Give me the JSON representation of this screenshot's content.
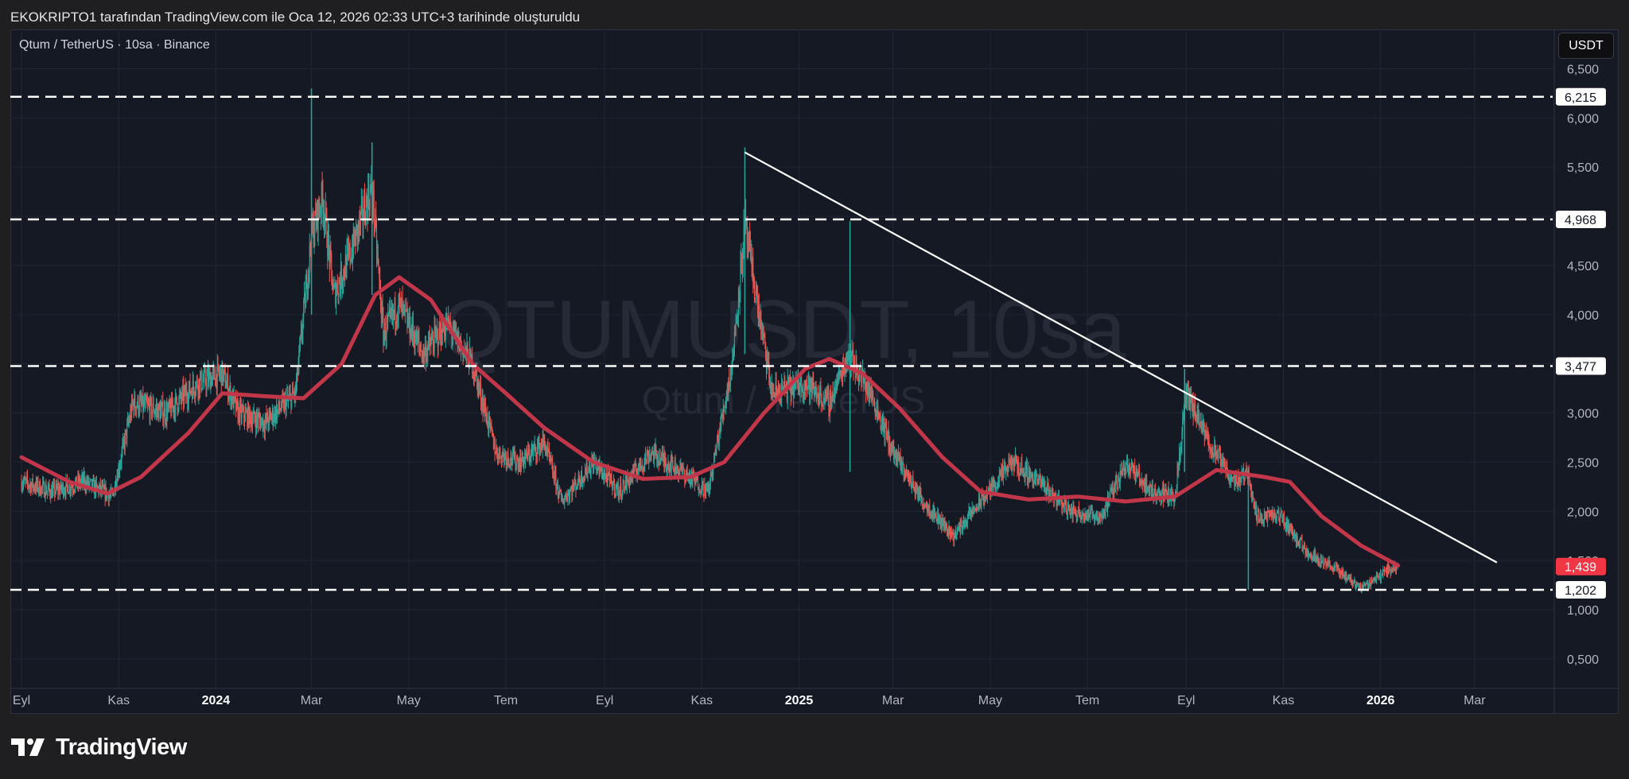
{
  "caption": "EKOKRIPTO1 tarafından TradingView.com ile Oca 12, 2026 02:33 UTC+3 tarihinde oluşturuldu",
  "symbol_title": "Qtum / TetherUS · 10sa · Binance",
  "currency_button": "USDT",
  "brand": "TradingView",
  "colors": {
    "background": "#151924",
    "up": "#26a69a",
    "down": "#ef5350",
    "ma": "#c2364a",
    "trendline": "#ffffff",
    "level": "#ffffff",
    "price_tag": "#f23645"
  },
  "chart_data": {
    "type": "candlestick",
    "watermark": {
      "symbol": "QTUMUSDT, 10sa",
      "name": "Qtum / TetherUS"
    },
    "y_axis": {
      "ticks": [
        "6,500",
        "6,000",
        "5,500",
        "5,000",
        "4,500",
        "4,000",
        "3,500",
        "3,000",
        "2,500",
        "2,000",
        "1,500",
        "1,000",
        "0,500"
      ],
      "tick_values": [
        6.5,
        6.0,
        5.5,
        5.0,
        4.5,
        4.0,
        3.5,
        3.0,
        2.5,
        2.0,
        1.5,
        1.0,
        0.5
      ],
      "range": [
        0.2,
        6.9
      ]
    },
    "x_axis": {
      "labels": [
        {
          "text": "Eyl",
          "date": "2023-09-01",
          "bold": false
        },
        {
          "text": "Kas",
          "date": "2023-11-01",
          "bold": false
        },
        {
          "text": "2024",
          "date": "2024-01-01",
          "bold": true
        },
        {
          "text": "Mar",
          "date": "2024-03-01",
          "bold": false
        },
        {
          "text": "May",
          "date": "2024-05-01",
          "bold": false
        },
        {
          "text": "Tem",
          "date": "2024-07-01",
          "bold": false
        },
        {
          "text": "Eyl",
          "date": "2024-09-01",
          "bold": false
        },
        {
          "text": "Kas",
          "date": "2024-11-01",
          "bold": false
        },
        {
          "text": "2025",
          "date": "2025-01-01",
          "bold": true
        },
        {
          "text": "Mar",
          "date": "2025-03-01",
          "bold": false
        },
        {
          "text": "May",
          "date": "2025-05-01",
          "bold": false
        },
        {
          "text": "Tem",
          "date": "2025-07-01",
          "bold": false
        },
        {
          "text": "Eyl",
          "date": "2025-09-01",
          "bold": false
        },
        {
          "text": "Kas",
          "date": "2025-11-01",
          "bold": false
        },
        {
          "text": "2026",
          "date": "2026-01-01",
          "bold": true
        },
        {
          "text": "Mar",
          "date": "2026-03-01",
          "bold": false
        }
      ]
    },
    "price_path": [
      {
        "date": "2023-09-01",
        "price": 2.3
      },
      {
        "date": "2023-09-20",
        "price": 2.2
      },
      {
        "date": "2023-10-10",
        "price": 2.3
      },
      {
        "date": "2023-10-28",
        "price": 2.15
      },
      {
        "date": "2023-11-10",
        "price": 3.1
      },
      {
        "date": "2023-12-01",
        "price": 3.0
      },
      {
        "date": "2023-12-20",
        "price": 3.3
      },
      {
        "date": "2024-01-05",
        "price": 3.4
      },
      {
        "date": "2024-01-15",
        "price": 3.0
      },
      {
        "date": "2024-02-01",
        "price": 2.9
      },
      {
        "date": "2024-02-20",
        "price": 3.2
      },
      {
        "date": "2024-03-01",
        "price": 4.8
      },
      {
        "date": "2024-03-08",
        "price": 5.2
      },
      {
        "date": "2024-03-15",
        "price": 4.2
      },
      {
        "date": "2024-03-25",
        "price": 4.6
      },
      {
        "date": "2024-04-08",
        "price": 5.3
      },
      {
        "date": "2024-04-15",
        "price": 3.8
      },
      {
        "date": "2024-04-25",
        "price": 4.1
      },
      {
        "date": "2024-05-10",
        "price": 3.6
      },
      {
        "date": "2024-05-25",
        "price": 3.9
      },
      {
        "date": "2024-06-10",
        "price": 3.5
      },
      {
        "date": "2024-06-25",
        "price": 2.6
      },
      {
        "date": "2024-07-10",
        "price": 2.5
      },
      {
        "date": "2024-07-25",
        "price": 2.7
      },
      {
        "date": "2024-08-05",
        "price": 2.1
      },
      {
        "date": "2024-08-25",
        "price": 2.5
      },
      {
        "date": "2024-09-10",
        "price": 2.2
      },
      {
        "date": "2024-09-30",
        "price": 2.6
      },
      {
        "date": "2024-10-20",
        "price": 2.4
      },
      {
        "date": "2024-11-05",
        "price": 2.2
      },
      {
        "date": "2024-11-20",
        "price": 3.5
      },
      {
        "date": "2024-11-28",
        "price": 4.9
      },
      {
        "date": "2024-12-05",
        "price": 4.2
      },
      {
        "date": "2024-12-15",
        "price": 3.2
      },
      {
        "date": "2025-01-05",
        "price": 3.3
      },
      {
        "date": "2025-01-20",
        "price": 3.1
      },
      {
        "date": "2025-02-01",
        "price": 3.6
      },
      {
        "date": "2025-02-15",
        "price": 3.2
      },
      {
        "date": "2025-03-01",
        "price": 2.6
      },
      {
        "date": "2025-03-20",
        "price": 2.1
      },
      {
        "date": "2025-04-08",
        "price": 1.75
      },
      {
        "date": "2025-04-25",
        "price": 2.1
      },
      {
        "date": "2025-05-15",
        "price": 2.5
      },
      {
        "date": "2025-06-01",
        "price": 2.3
      },
      {
        "date": "2025-06-20",
        "price": 2.0
      },
      {
        "date": "2025-07-10",
        "price": 1.95
      },
      {
        "date": "2025-07-25",
        "price": 2.5
      },
      {
        "date": "2025-08-10",
        "price": 2.2
      },
      {
        "date": "2025-08-25",
        "price": 2.15
      },
      {
        "date": "2025-09-01",
        "price": 3.2
      },
      {
        "date": "2025-09-15",
        "price": 2.7
      },
      {
        "date": "2025-10-01",
        "price": 2.3
      },
      {
        "date": "2025-10-10",
        "price": 2.4
      },
      {
        "date": "2025-10-15",
        "price": 1.95
      },
      {
        "date": "2025-10-30",
        "price": 1.95
      },
      {
        "date": "2025-11-15",
        "price": 1.6
      },
      {
        "date": "2025-12-05",
        "price": 1.4
      },
      {
        "date": "2025-12-20",
        "price": 1.22
      },
      {
        "date": "2026-01-05",
        "price": 1.4
      },
      {
        "date": "2026-01-12",
        "price": 1.439
      }
    ],
    "spikes": [
      {
        "date": "2024-03-01",
        "high": 6.3,
        "low": 4.0
      },
      {
        "date": "2024-04-08",
        "high": 5.75,
        "low": 4.2
      },
      {
        "date": "2024-11-28",
        "high": 5.7,
        "low": 3.6
      },
      {
        "date": "2025-02-02",
        "high": 4.95,
        "low": 2.4
      },
      {
        "date": "2025-08-31",
        "high": 3.45,
        "low": 2.4
      },
      {
        "date": "2025-10-10",
        "high": 2.45,
        "low": 1.2
      }
    ],
    "moving_average": [
      {
        "date": "2023-09-01",
        "value": 2.55
      },
      {
        "date": "2023-10-01",
        "value": 2.3
      },
      {
        "date": "2023-10-25",
        "value": 2.18
      },
      {
        "date": "2023-11-15",
        "value": 2.35
      },
      {
        "date": "2023-12-15",
        "value": 2.8
      },
      {
        "date": "2024-01-05",
        "value": 3.2
      },
      {
        "date": "2024-02-01",
        "value": 3.17
      },
      {
        "date": "2024-02-25",
        "value": 3.15
      },
      {
        "date": "2024-03-20",
        "value": 3.5
      },
      {
        "date": "2024-04-10",
        "value": 4.2
      },
      {
        "date": "2024-04-25",
        "value": 4.38
      },
      {
        "date": "2024-05-15",
        "value": 4.15
      },
      {
        "date": "2024-06-10",
        "value": 3.5
      },
      {
        "date": "2024-07-01",
        "value": 3.2
      },
      {
        "date": "2024-07-25",
        "value": 2.85
      },
      {
        "date": "2024-08-25",
        "value": 2.5
      },
      {
        "date": "2024-09-25",
        "value": 2.33
      },
      {
        "date": "2024-10-25",
        "value": 2.35
      },
      {
        "date": "2024-11-15",
        "value": 2.5
      },
      {
        "date": "2024-12-10",
        "value": 3.0
      },
      {
        "date": "2025-01-05",
        "value": 3.45
      },
      {
        "date": "2025-01-20",
        "value": 3.55
      },
      {
        "date": "2025-02-10",
        "value": 3.4
      },
      {
        "date": "2025-03-05",
        "value": 3.05
      },
      {
        "date": "2025-04-01",
        "value": 2.55
      },
      {
        "date": "2025-04-25",
        "value": 2.2
      },
      {
        "date": "2025-05-25",
        "value": 2.12
      },
      {
        "date": "2025-06-25",
        "value": 2.15
      },
      {
        "date": "2025-07-25",
        "value": 2.1
      },
      {
        "date": "2025-08-25",
        "value": 2.15
      },
      {
        "date": "2025-09-20",
        "value": 2.42
      },
      {
        "date": "2025-10-20",
        "value": 2.35
      },
      {
        "date": "2025-11-05",
        "value": 2.3
      },
      {
        "date": "2025-11-25",
        "value": 1.95
      },
      {
        "date": "2025-12-20",
        "value": 1.65
      },
      {
        "date": "2026-01-12",
        "value": 1.45
      }
    ],
    "trendline": {
      "start": {
        "date": "2024-11-28",
        "price": 5.65
      },
      "end": {
        "date": "2026-03-15",
        "price": 1.48
      }
    },
    "horizontal_levels": [
      {
        "price": 6.215,
        "label": "6,215"
      },
      {
        "price": 4.968,
        "label": "4,968"
      },
      {
        "price": 3.477,
        "label": "3,477"
      },
      {
        "price": 1.202,
        "label": "1,202"
      }
    ],
    "last_price": {
      "price": 1.439,
      "label": "1,439"
    },
    "grid": true
  }
}
